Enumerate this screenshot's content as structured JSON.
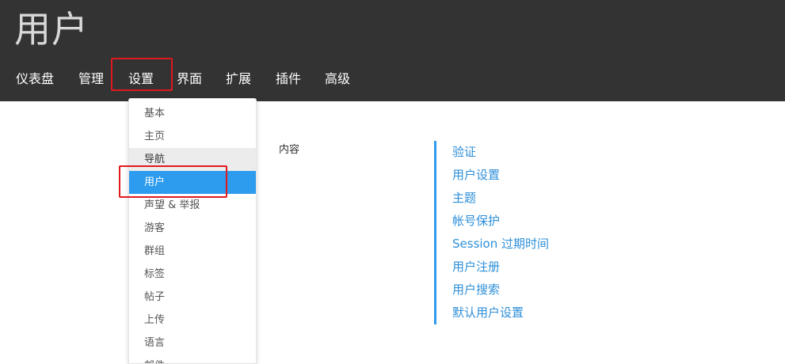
{
  "header": {
    "title": "用户",
    "nav": [
      "仪表盘",
      "管理",
      "设置",
      "界面",
      "扩展",
      "插件",
      "高级"
    ]
  },
  "dropdown": {
    "items": [
      "基本",
      "主页",
      "导航",
      "用户",
      "声望 & 举报",
      "游客",
      "群组",
      "标签",
      "帖子",
      "上传",
      "语言",
      "邮件"
    ],
    "hover_item": "导航",
    "active_item": "用户"
  },
  "content": {
    "label": "内容",
    "toc": [
      "验证",
      "用户设置",
      "主题",
      "帐号保护",
      "Session 过期时间",
      "用户注册",
      "用户搜索",
      "默认用户设置"
    ]
  },
  "colors": {
    "header_bg": "#333333",
    "accent": "#2d9cee",
    "highlight_box": "#e0191e"
  }
}
